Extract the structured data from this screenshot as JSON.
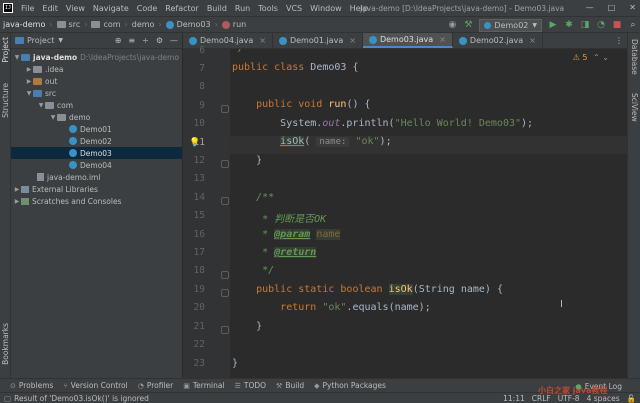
{
  "menu": {
    "items": [
      "File",
      "Edit",
      "View",
      "Navigate",
      "Code",
      "Refactor",
      "Build",
      "Run",
      "Tools",
      "VCS",
      "Window",
      "Help"
    ],
    "window_title": "java-demo [D:\\IdeaProjects\\java-demo] - Demo03.java"
  },
  "nav": {
    "crumbs": [
      "java-demo",
      "src",
      "com",
      "demo",
      "Demo03",
      "run"
    ],
    "run_config": "Demo02"
  },
  "left_strip": {
    "project": "Project",
    "structure": "Structure",
    "bookmarks": "Bookmarks"
  },
  "right_strip": {
    "database": "Database",
    "sciview": "SciView"
  },
  "project_panel": {
    "title": "Project",
    "tree": [
      {
        "label": "java-demo",
        "path": "D:\\IdeaProjects\\java-demo"
      },
      {
        "label": ".idea"
      },
      {
        "label": "out"
      },
      {
        "label": "src"
      },
      {
        "label": "com"
      },
      {
        "label": "demo"
      },
      {
        "label": "Demo01"
      },
      {
        "label": "Demo02"
      },
      {
        "label": "Demo03"
      },
      {
        "label": "Demo04"
      },
      {
        "label": "java-demo.iml"
      },
      {
        "label": "External Libraries"
      },
      {
        "label": "Scratches and Consoles"
      }
    ]
  },
  "tabs": [
    "Demo04.java",
    "Demo01.java",
    "Demo03.java",
    "Demo02.java"
  ],
  "editor": {
    "warnings": "5",
    "line_numbers": [
      "6",
      "7",
      "8",
      "9",
      "10",
      "11",
      "12",
      "13",
      "14",
      "15",
      "16",
      "17",
      "18",
      "19",
      "20",
      "21",
      "22",
      "23"
    ],
    "tokens": {
      "l6": "*/",
      "public": "public",
      "class": "class",
      "demo03": "Demo03 {",
      "void": "void",
      "run": "run",
      "run_rest": "() {",
      "system": "System.",
      "out": "out",
      "println_open": ".println(",
      "hello": "\"Hello World! Demo03\"",
      "println_close": ");",
      "isok": "isOk",
      "paren_open": "(",
      "hint": "name:",
      "ok_str": "\"ok\"",
      "call_close": ");",
      "close_brace": "}",
      "doc_open": "/**",
      "doc_desc": " * 判断是否OK",
      "star": " * ",
      "param_tag": "@param",
      "param_name": "name",
      "return_tag": "@return",
      "doc_close": " */",
      "static": "static",
      "boolean": "boolean",
      "sig_rest": "(String name) {",
      "return": "return",
      "equals": ".equals(name);",
      "class_close": "}"
    }
  },
  "tool_windows": [
    "Problems",
    "Version Control",
    "Profiler",
    "Terminal",
    "TODO",
    "Build",
    "Python Packages"
  ],
  "event_log": "Event Log",
  "status": {
    "message": "Result of 'Demo03.isOk()' is ignored",
    "position": "11:11",
    "line_sep": "CRLF",
    "encoding": "UTF-8",
    "indent": "4 spaces"
  },
  "watermark": "小白之家 java教程"
}
